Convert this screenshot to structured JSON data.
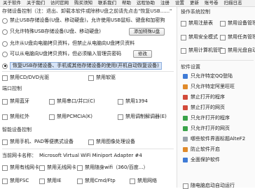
{
  "menu": [
    "关于软件",
    "关于我们",
    "访问官网",
    "购买须知",
    "联系我们",
    "帮助",
    "远程协助",
    "注册",
    "设置",
    "更新",
    "账号卷",
    "扫描日志"
  ],
  "usb": {
    "title": "存储设备控制（注：退出、卸载本软件或除移U盘之前请先点击\"恢复USB......\"",
    "opts": [
      "禁止USB存储设备(U盘、移动硬盘)，允许使用USB鼠标、键盘和加密狗",
      "只允许特殊USB存储设备(U盘、移动硬盘)",
      "允许从U盘向电脑拷贝资料，但禁止从电脑向U盘拷贝资料",
      "可以从电脑向U盘拷贝资料，但必须输入管理员密码",
      "恢复USB存储设备、手机或其他存储设备的使用(开机自动恢复设备)"
    ],
    "btn_add": "添加特殊U盘",
    "btn_modify": "修改"
  },
  "disk": {
    "cd": "禁用CD/DVD光驱",
    "floppy": "禁用软驱"
  },
  "port": {
    "title": "端口控制",
    "items": [
      "禁用蓝牙",
      "禁用串口/并口(C)",
      "禁用1394",
      "禁用红外",
      "禁用PCMCIA(K)",
      "禁用调制解调器(E)"
    ]
  },
  "smart": {
    "title": "智能设备控制",
    "items": [
      "禁用手机、PAD等便携式设备",
      "禁用图像处理设备"
    ]
  },
  "net": {
    "adapter_label": "当前网卡名称：",
    "adapter_value": "Microsoft Virtual WiFi Miniport Adapter #4",
    "items": [
      "禁用有线网卡",
      "禁用无线网卡",
      "禁用随身wifi（360/百度...）",
      "禁用FSC",
      "禁用IE",
      "禁用Cmd/Ftp",
      "禁用网络"
    ]
  },
  "os": {
    "title": "操作系统控制",
    "items": [
      "禁用注册表",
      "禁用设备管理",
      "禁用安全模式",
      "禁用任务管理",
      "禁用计算机管理",
      "禁用光盘自动"
    ]
  },
  "soft": {
    "title": "软件设置",
    "items": [
      "只允许特定QQ登陆",
      "只允许特定阿里旺旺",
      "禁止打开的程序",
      "禁止打开的网页",
      "只允许打开的程序",
      "只允许打开的网页",
      "哪些软件界面标题AlteF2",
      "防止软件开启",
      "全面保护软件"
    ],
    "startup": "随电脑启动自动运行"
  }
}
